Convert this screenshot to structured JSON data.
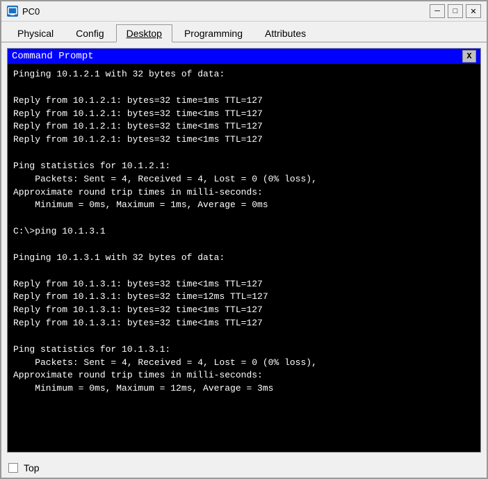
{
  "window": {
    "title": "PC0",
    "icon_label": "PC",
    "minimize_btn": "─",
    "maximize_btn": "□",
    "close_btn": "✕"
  },
  "tabs": [
    {
      "label": "Physical",
      "active": false
    },
    {
      "label": "Config",
      "active": false
    },
    {
      "label": "Desktop",
      "active": true
    },
    {
      "label": "Programming",
      "active": false
    },
    {
      "label": "Attributes",
      "active": false
    }
  ],
  "cmd": {
    "title": "Command Prompt",
    "close_label": "X",
    "content": "Pinging 10.1.2.1 with 32 bytes of data:\n\nReply from 10.1.2.1: bytes=32 time=1ms TTL=127\nReply from 10.1.2.1: bytes=32 time<1ms TTL=127\nReply from 10.1.2.1: bytes=32 time<1ms TTL=127\nReply from 10.1.2.1: bytes=32 time<1ms TTL=127\n\nPing statistics for 10.1.2.1:\n    Packets: Sent = 4, Received = 4, Lost = 0 (0% loss),\nApproximate round trip times in milli-seconds:\n    Minimum = 0ms, Maximum = 1ms, Average = 0ms\n\nC:\\>ping 10.1.3.1\n\nPinging 10.1.3.1 with 32 bytes of data:\n\nReply from 10.1.3.1: bytes=32 time<1ms TTL=127\nReply from 10.1.3.1: bytes=32 time=12ms TTL=127\nReply from 10.1.3.1: bytes=32 time<1ms TTL=127\nReply from 10.1.3.1: bytes=32 time<1ms TTL=127\n\nPing statistics for 10.1.3.1:\n    Packets: Sent = 4, Received = 4, Lost = 0 (0% loss),\nApproximate round trip times in milli-seconds:\n    Minimum = 0ms, Maximum = 12ms, Average = 3ms"
  },
  "bottom": {
    "checkbox_label": "Top"
  }
}
